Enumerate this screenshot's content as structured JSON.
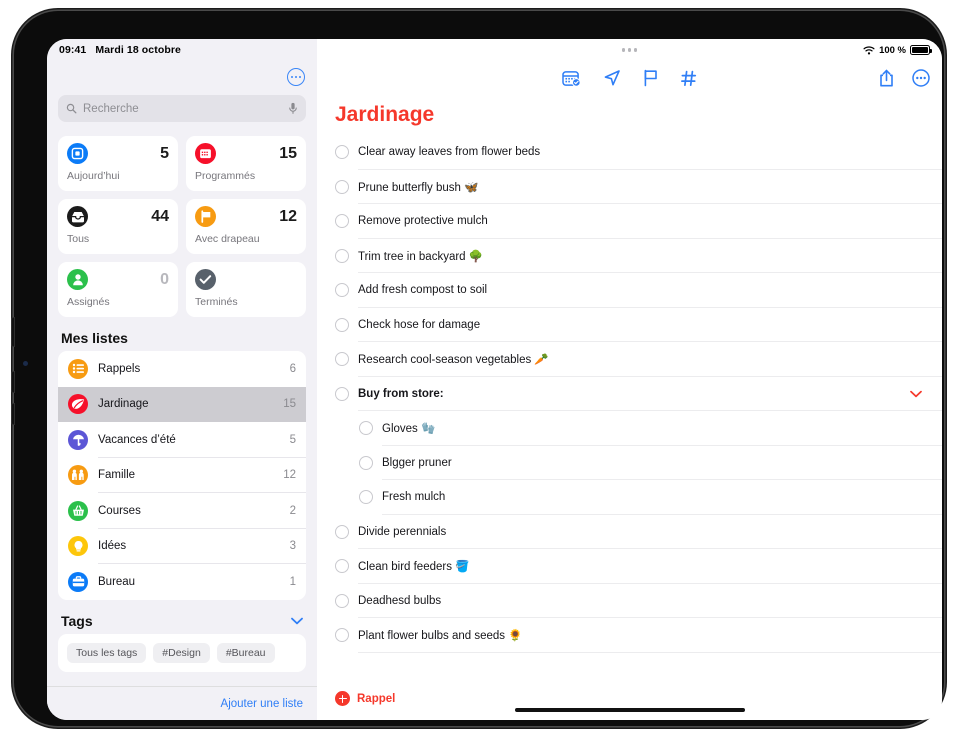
{
  "status_bar": {
    "time": "09:41",
    "date": "Mardi 18 octobre",
    "wifi_icon": "wifi-icon",
    "battery_percent": "100 %",
    "battery_icon": "battery-full-icon",
    "multitask_icon": "multitasking-dots-icon"
  },
  "sidebar": {
    "more_button_icon": "more-circle-icon",
    "search": {
      "placeholder": "Recherche",
      "value": "",
      "search_icon": "search-icon",
      "mic_icon": "microphone-icon"
    },
    "smart_lists": [
      {
        "label": "Aujourd’hui",
        "count": "5",
        "color": "#0b7bf7",
        "icon": "today-calendar-icon",
        "dim": false
      },
      {
        "label": "Programmés",
        "count": "15",
        "color": "#f6102a",
        "icon": "scheduled-calendar-icon",
        "dim": false
      },
      {
        "label": "Tous",
        "count": "44",
        "color": "#1b1b1b",
        "icon": "all-inbox-icon",
        "dim": false
      },
      {
        "label": "Avec drapeau",
        "count": "12",
        "color": "#f79b12",
        "icon": "flag-icon",
        "dim": false
      },
      {
        "label": "Assignés",
        "count": "0",
        "color": "#2bc04b",
        "icon": "person-icon",
        "dim": true
      },
      {
        "label": "Terminés",
        "count": "",
        "color": "#58616b",
        "icon": "checkmark-icon",
        "dim": false
      }
    ],
    "my_lists_title": "Mes listes",
    "lists": [
      {
        "name": "Rappels",
        "count": "6",
        "color": "#f79b12",
        "icon": "list-bullet-icon",
        "selected": false
      },
      {
        "name": "Jardinage",
        "count": "15",
        "color": "#f6102a",
        "icon": "leaf-icon",
        "selected": true
      },
      {
        "name": "Vacances d’été",
        "count": "5",
        "color": "#5c56d6",
        "icon": "beach-umbrella-icon",
        "selected": false
      },
      {
        "name": "Famille",
        "count": "12",
        "color": "#f79b12",
        "icon": "family-icon",
        "selected": false
      },
      {
        "name": "Courses",
        "count": "2",
        "color": "#2bc04b",
        "icon": "basket-icon",
        "selected": false
      },
      {
        "name": "Idées",
        "count": "3",
        "color": "#fdc60b",
        "icon": "lightbulb-icon",
        "selected": false
      },
      {
        "name": "Bureau",
        "count": "1",
        "color": "#0b7bf7",
        "icon": "briefcase-icon",
        "selected": false
      }
    ],
    "tags_title": "Tags",
    "tags_collapse_icon": "chevron-down-icon",
    "tags": [
      "Tous les tags",
      "#Design",
      "#Bureau"
    ],
    "add_list_label": "Ajouter une liste"
  },
  "main": {
    "toolbar": {
      "center_icons": [
        {
          "name": "calendar-badge-icon",
          "label": "Date"
        },
        {
          "name": "location-arrow-icon",
          "label": "Lieu"
        },
        {
          "name": "flag-outline-icon",
          "label": "Drapeau"
        },
        {
          "name": "hashtag-icon",
          "label": "Tag"
        }
      ],
      "right_icons": [
        {
          "name": "share-icon",
          "label": "Partager"
        },
        {
          "name": "more-circle-icon",
          "label": "Plus"
        }
      ]
    },
    "title": "Jardinage",
    "title_color": "#f5382b",
    "tasks": [
      {
        "text": "Clear away leaves from flower beds",
        "level": 0,
        "group": false,
        "collapse_icon": ""
      },
      {
        "text": "Prune butterfly bush 🦋",
        "level": 0,
        "group": false,
        "collapse_icon": ""
      },
      {
        "text": "Remove protective mulch",
        "level": 0,
        "group": false,
        "collapse_icon": ""
      },
      {
        "text": "Trim tree in backyard 🌳",
        "level": 0,
        "group": false,
        "collapse_icon": ""
      },
      {
        "text": "Add fresh compost to soil",
        "level": 0,
        "group": false,
        "collapse_icon": ""
      },
      {
        "text": "Check hose for damage",
        "level": 0,
        "group": false,
        "collapse_icon": ""
      },
      {
        "text": "Research cool-season vegetables 🥕",
        "level": 0,
        "group": false,
        "collapse_icon": ""
      },
      {
        "text": "Buy from store:",
        "level": 0,
        "group": true,
        "collapse_icon": "chevron-down-icon"
      },
      {
        "text": "Gloves 🧤",
        "level": 1,
        "group": false,
        "collapse_icon": ""
      },
      {
        "text": "Blgger pruner",
        "level": 1,
        "group": false,
        "collapse_icon": ""
      },
      {
        "text": "Fresh mulch",
        "level": 1,
        "group": false,
        "collapse_icon": ""
      },
      {
        "text": "Divide perennials",
        "level": 0,
        "group": false,
        "collapse_icon": ""
      },
      {
        "text": "Clean bird feeders 🪣",
        "level": 0,
        "group": false,
        "collapse_icon": ""
      },
      {
        "text": "Deadhesd bulbs",
        "level": 0,
        "group": false,
        "collapse_icon": ""
      },
      {
        "text": "Plant flower bulbs and seeds 🌻",
        "level": 0,
        "group": false,
        "collapse_icon": ""
      }
    ],
    "add_reminder_label": "Rappel",
    "add_reminder_icon": "plus-circle-icon"
  }
}
